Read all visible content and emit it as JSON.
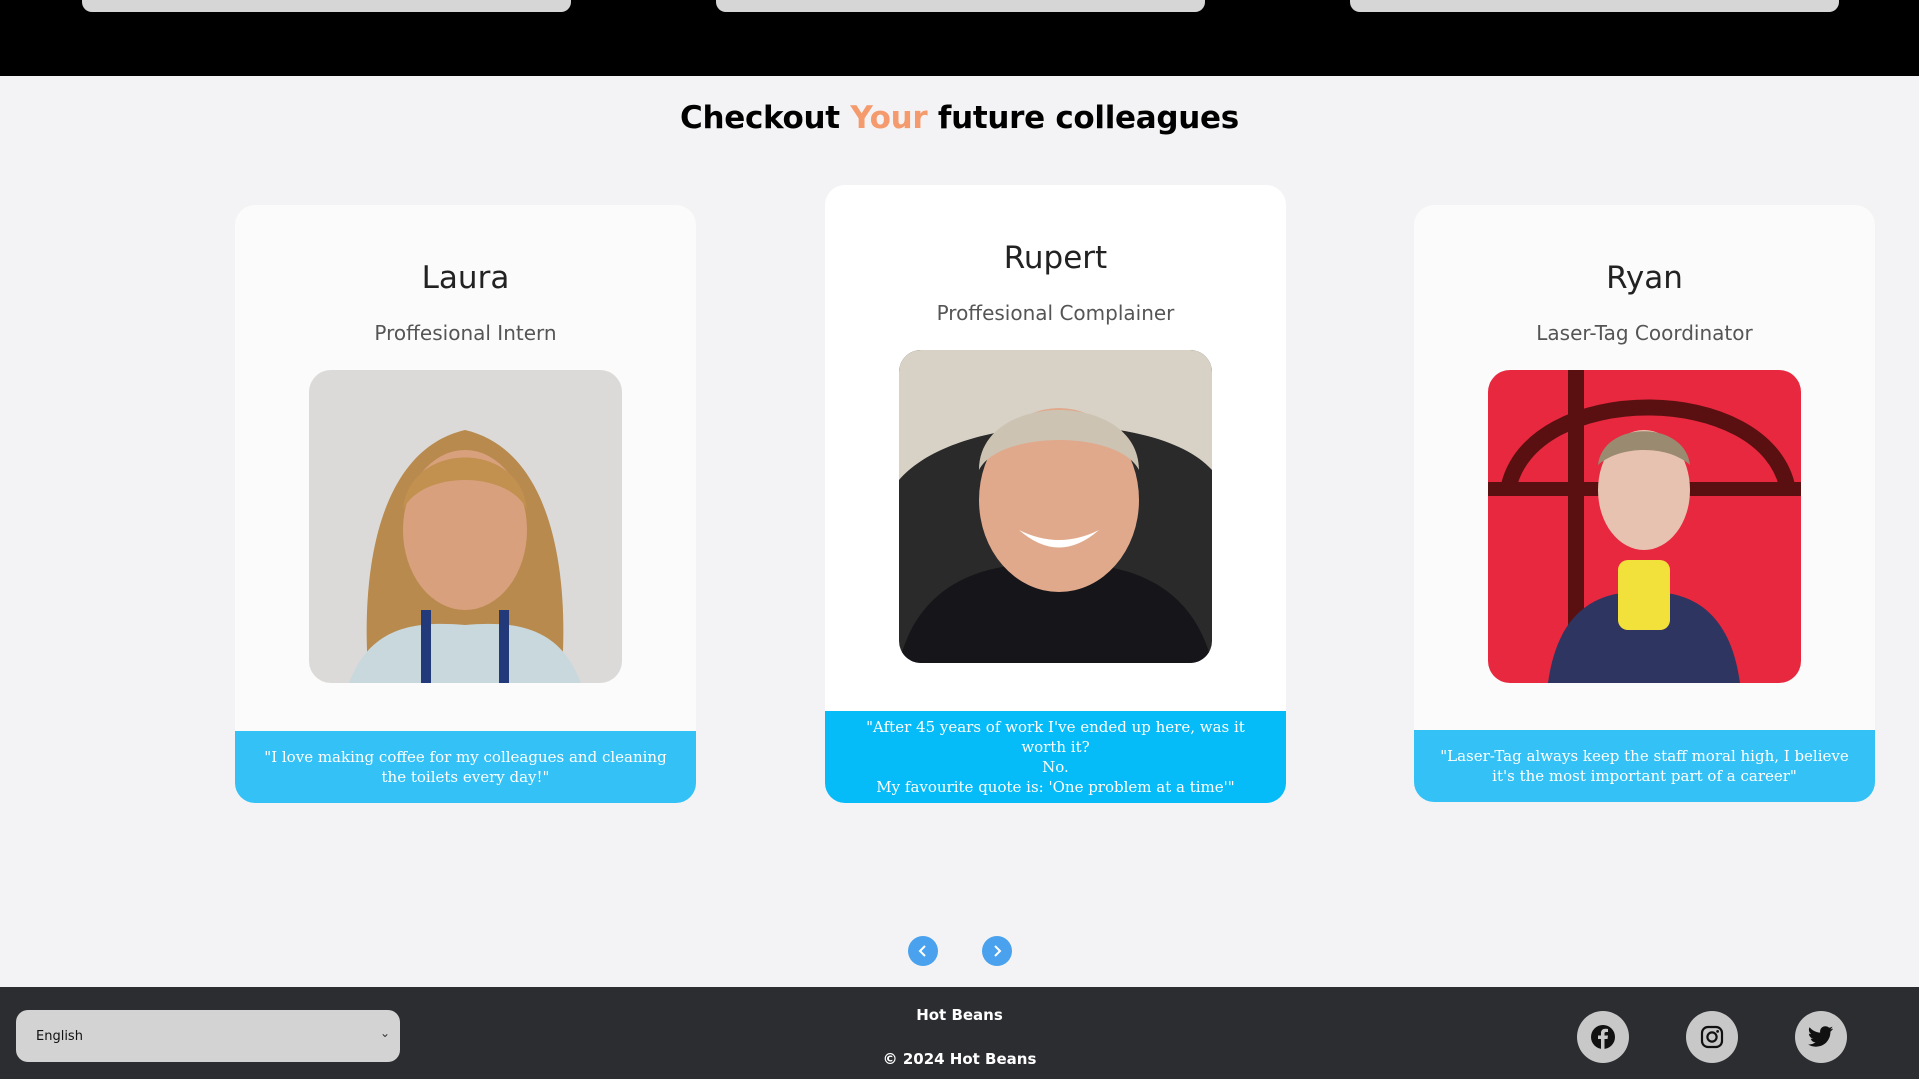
{
  "section": {
    "heading_before": "Checkout ",
    "heading_accent": "Your",
    "heading_after": " future colleagues",
    "accent_color": "#f49a6c"
  },
  "cards": [
    {
      "name": "Laura",
      "role": "Proffesional Intern",
      "quote": "\"I love making coffee for my colleagues and cleaning the toilets every day!\"",
      "photo": "portrait-photo-laura"
    },
    {
      "name": "Rupert",
      "role": "Proffesional Complainer",
      "quote_line1": "\"After 45 years of work I've ended up here, was it worth it?",
      "quote_line2": "No.",
      "quote_line3": "My favourite quote is: 'One problem at a time'\"",
      "photo": "portrait-photo-rupert"
    },
    {
      "name": "Ryan",
      "role": "Laser-Tag Coordinator",
      "quote": "\"Laser-Tag always keep the staff moral high, I believe it's the most important part of a career\"",
      "photo": "portrait-photo-ryan"
    }
  ],
  "carousel": {
    "prev_icon": "chevron-left-icon",
    "next_icon": "chevron-right-icon",
    "button_color": "#4aa2ee"
  },
  "footer": {
    "language_selected": "English",
    "brand": "Hot Beans",
    "copyright": "© 2024 Hot Beans",
    "social_icons": [
      "facebook-icon",
      "instagram-icon",
      "twitter-icon"
    ]
  },
  "colors": {
    "quote_bar": "#05bbf8",
    "footer_bg": "#2b2d31"
  }
}
